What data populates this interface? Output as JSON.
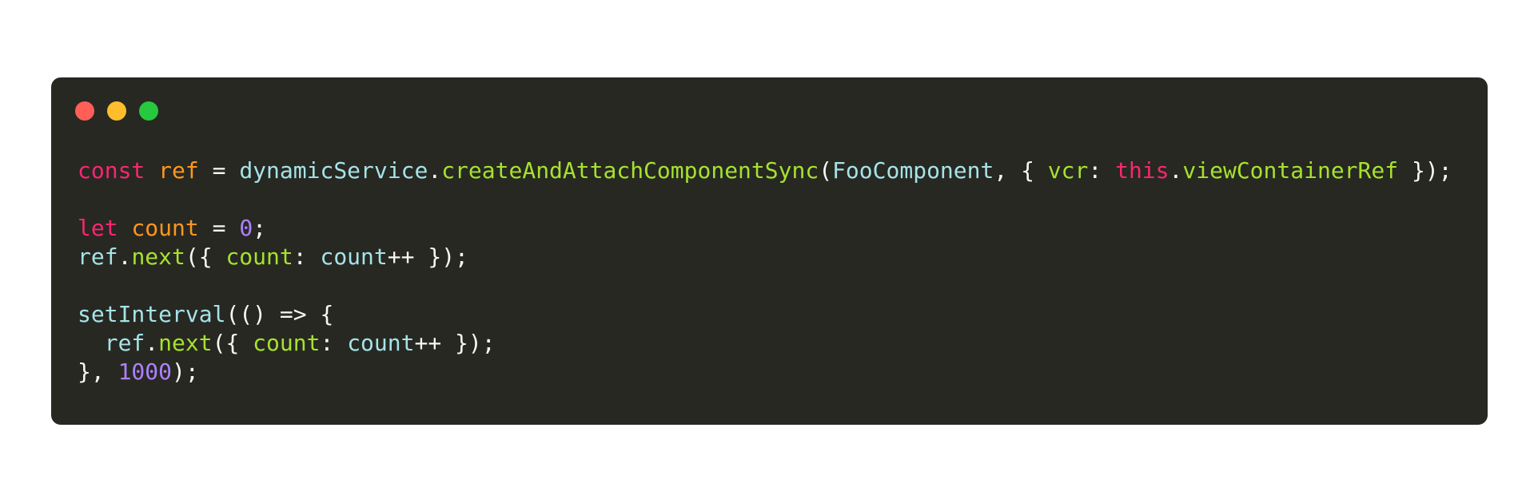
{
  "window": {
    "controls": [
      {
        "name": "close",
        "color": "#ff5f56"
      },
      {
        "name": "minimize",
        "color": "#ffbd2e"
      },
      {
        "name": "maximize",
        "color": "#27c93f"
      }
    ]
  },
  "theme": {
    "background": "#272822",
    "default": "#f8f8f2",
    "keyword": "#f92672",
    "variable": "#fd971f",
    "identifier": "#a6e3e8",
    "function": "#a6e22e",
    "number": "#ae81ff"
  },
  "code": {
    "lines": [
      [
        {
          "t": "const",
          "c": "keyword"
        },
        {
          "t": " ",
          "c": "default"
        },
        {
          "t": "ref",
          "c": "variable"
        },
        {
          "t": " = ",
          "c": "default"
        },
        {
          "t": "dynamicService",
          "c": "identifier"
        },
        {
          "t": ".",
          "c": "default"
        },
        {
          "t": "createAndAttachComponentSync",
          "c": "function"
        },
        {
          "t": "(",
          "c": "default"
        },
        {
          "t": "FooComponent",
          "c": "identifier"
        },
        {
          "t": ", { ",
          "c": "default"
        },
        {
          "t": "vcr",
          "c": "function"
        },
        {
          "t": ": ",
          "c": "default"
        },
        {
          "t": "this",
          "c": "keyword"
        },
        {
          "t": ".",
          "c": "default"
        },
        {
          "t": "viewContainerRef",
          "c": "function"
        },
        {
          "t": " });",
          "c": "default"
        }
      ],
      [],
      [
        {
          "t": "let",
          "c": "keyword"
        },
        {
          "t": " ",
          "c": "default"
        },
        {
          "t": "count",
          "c": "variable"
        },
        {
          "t": " = ",
          "c": "default"
        },
        {
          "t": "0",
          "c": "number"
        },
        {
          "t": ";",
          "c": "default"
        }
      ],
      [
        {
          "t": "ref",
          "c": "identifier"
        },
        {
          "t": ".",
          "c": "default"
        },
        {
          "t": "next",
          "c": "function"
        },
        {
          "t": "({ ",
          "c": "default"
        },
        {
          "t": "count",
          "c": "function"
        },
        {
          "t": ": ",
          "c": "default"
        },
        {
          "t": "count",
          "c": "identifier"
        },
        {
          "t": "++ });",
          "c": "default"
        }
      ],
      [],
      [
        {
          "t": "setInterval",
          "c": "identifier"
        },
        {
          "t": "(() => {",
          "c": "default"
        }
      ],
      [
        {
          "t": "  ",
          "c": "default"
        },
        {
          "t": "ref",
          "c": "identifier"
        },
        {
          "t": ".",
          "c": "default"
        },
        {
          "t": "next",
          "c": "function"
        },
        {
          "t": "({ ",
          "c": "default"
        },
        {
          "t": "count",
          "c": "function"
        },
        {
          "t": ": ",
          "c": "default"
        },
        {
          "t": "count",
          "c": "identifier"
        },
        {
          "t": "++ });",
          "c": "default"
        }
      ],
      [
        {
          "t": "}, ",
          "c": "default"
        },
        {
          "t": "1000",
          "c": "number"
        },
        {
          "t": ");",
          "c": "default"
        }
      ]
    ]
  }
}
